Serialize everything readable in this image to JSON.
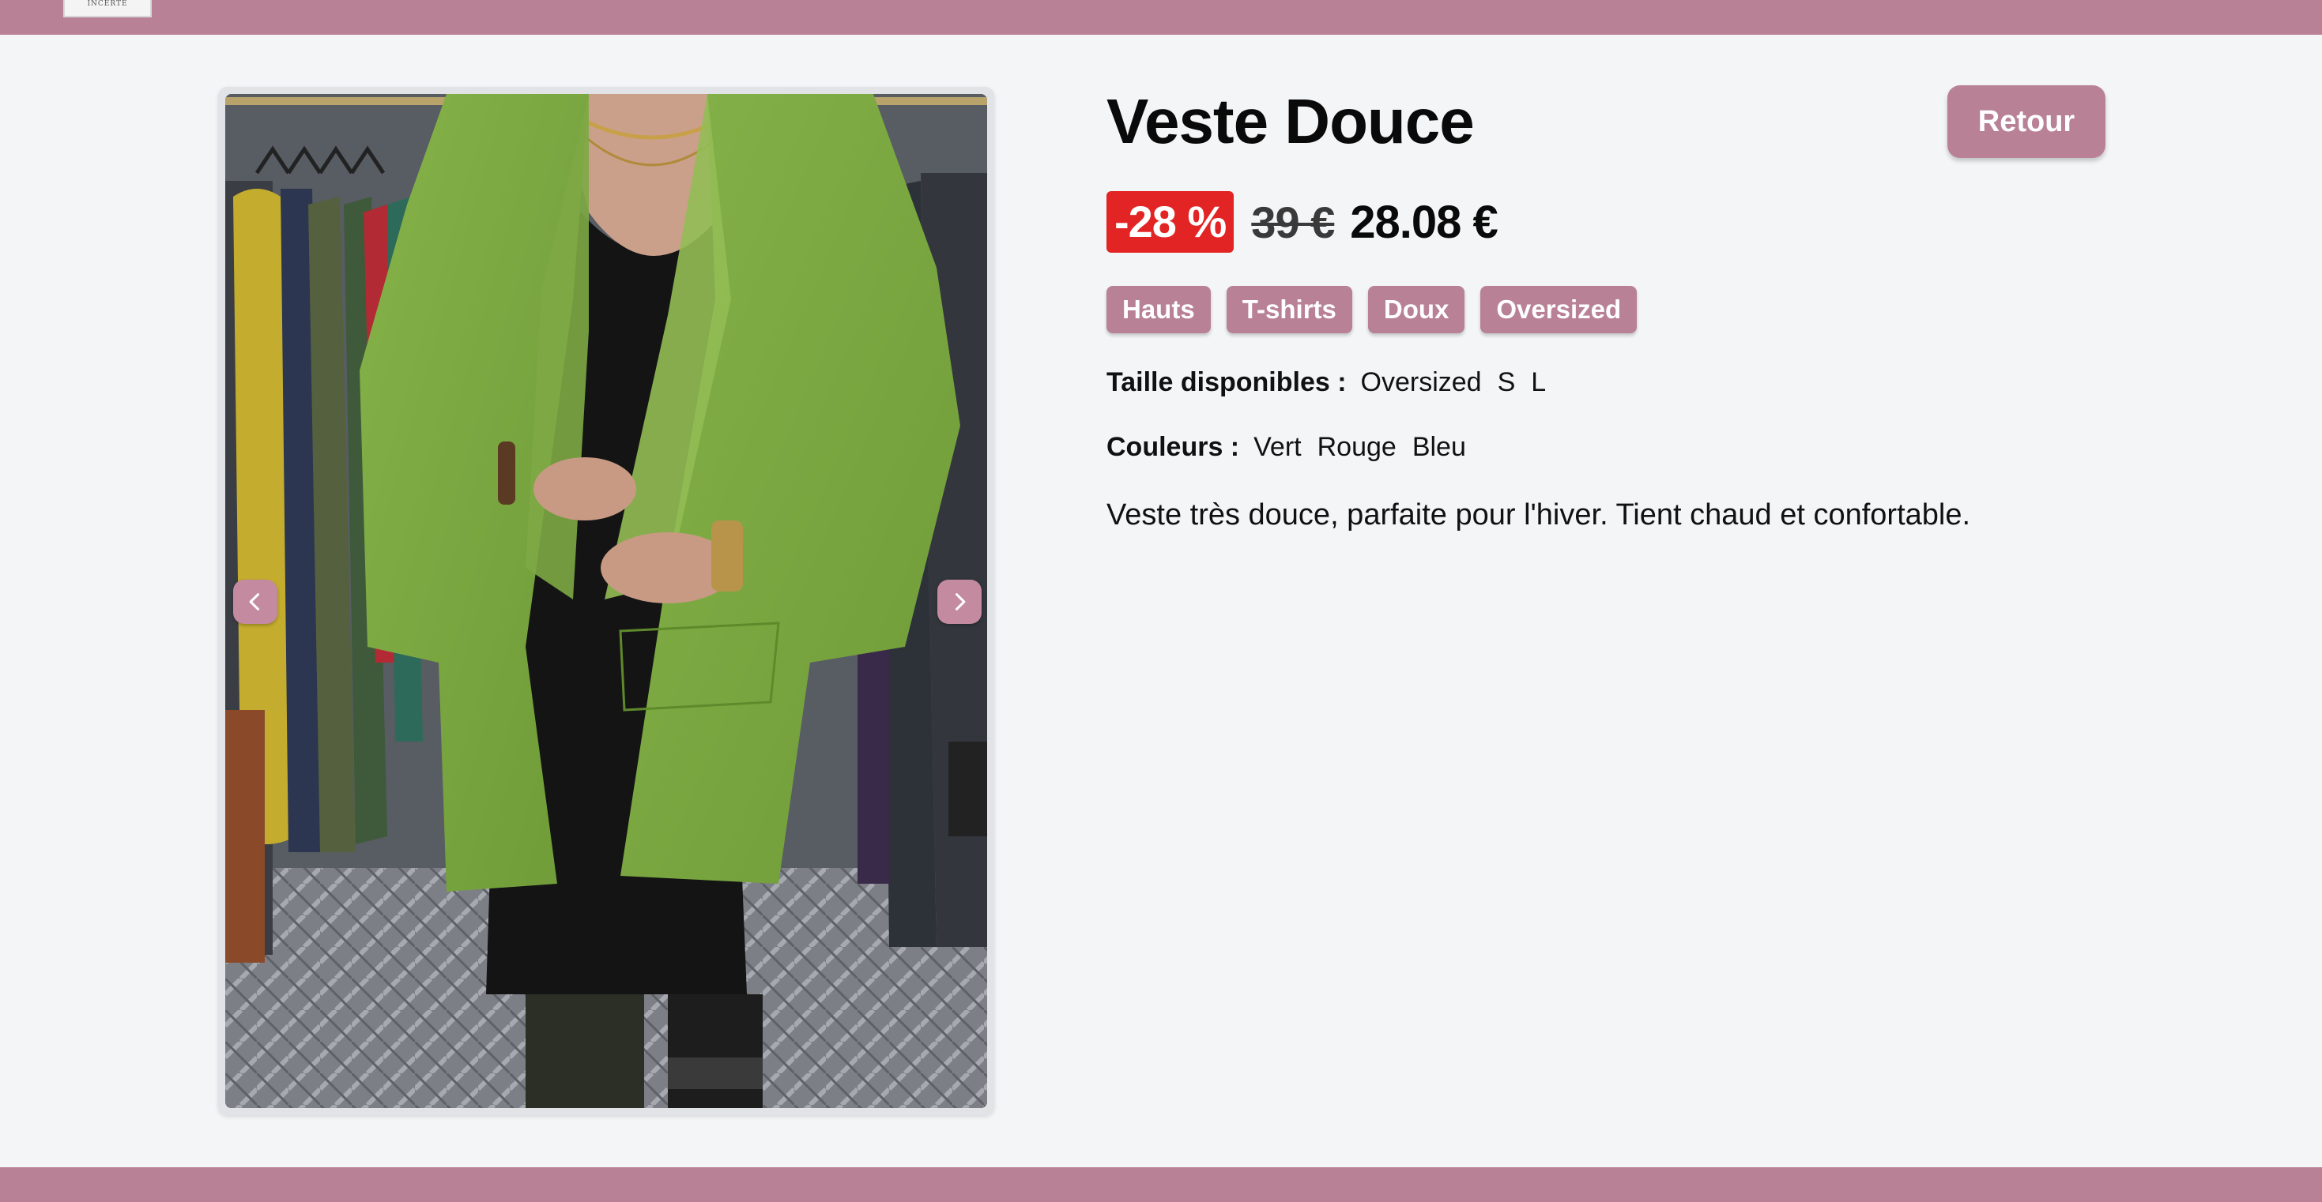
{
  "header": {
    "logo_text": "INCERTE"
  },
  "product": {
    "title": "Veste Douce",
    "back_label": "Retour",
    "discount_label": "-28 %",
    "old_price": "39 €",
    "new_price": "28.08 €",
    "tags": [
      "Hauts",
      "T-shirts",
      "Doux",
      "Oversized"
    ],
    "sizes_label": "Taille disponibles :",
    "sizes": [
      "Oversized",
      "S",
      "L"
    ],
    "colors_label": "Couleurs :",
    "colors": [
      "Vert",
      "Rouge",
      "Bleu"
    ],
    "description": "Veste très douce, parfaite pour l'hiver. Tient chaud et confortable."
  },
  "gallery": {
    "image_subject": "green-jacket-photo",
    "prev_icon": "chevron-left-icon",
    "next_icon": "chevron-right-icon"
  },
  "colors": {
    "brand": "#b98196",
    "discount": "#e32424",
    "background": "#f3f5f7"
  }
}
